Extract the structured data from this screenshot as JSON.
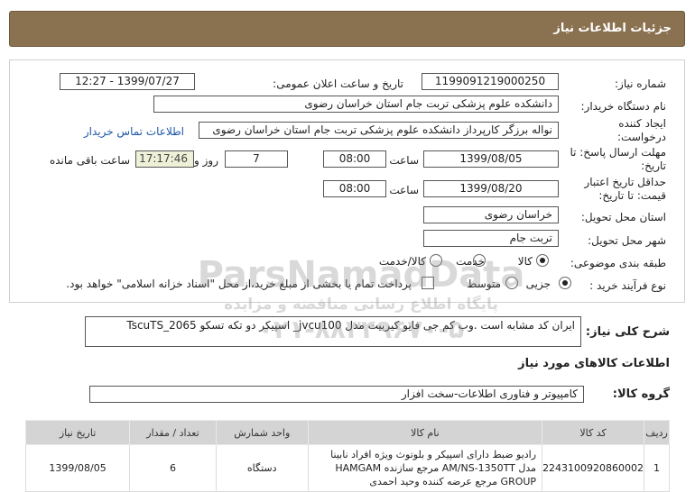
{
  "header": {
    "title": "جزئیات اطلاعات نیاز"
  },
  "form": {
    "need_number_label": "شماره نیاز:",
    "need_number": "1199091219000250",
    "announce_label": "تاریخ و ساعت اعلان عمومی:",
    "announce_value": "1399/07/27 - 12:27",
    "buyer_label": "نام دستگاه خریدار:",
    "buyer_value": "دانشکده علوم پزشکی تربت جام استان خراسان رضوی",
    "creator_label": "ایجاد کننده درخواست:",
    "creator_value": "نواله برزگر کارپرداز دانشکده علوم پزشکی تربت جام استان خراسان رضوی",
    "contact_link": "اطلاعات تماس خریدار",
    "send_deadline_label": "مهلت ارسال پاسخ: تا تاریخ:",
    "send_date": "1399/08/05",
    "time_label": "ساعت",
    "send_time": "08:00",
    "days_value": "7",
    "days_label": "روز و",
    "remaining_time": "17:17:46",
    "remaining_label": "ساعت باقی مانده",
    "validity_label": "حداقل تاریخ اعتبار قیمت: تا تاریخ:",
    "validity_date": "1399/08/20",
    "validity_time": "08:00",
    "province_label": "استان محل تحویل:",
    "province_value": "خراسان رضوی",
    "city_label": "شهر محل تحویل:",
    "city_value": "تربت جام",
    "category_label": "طبقه بندی موضوعی:",
    "category_options": [
      "کالا",
      "خدمت",
      "کالا/خدمت"
    ],
    "purchase_label": "نوع فرآیند خرید :",
    "purchase_options": [
      "جزیی",
      "متوسط"
    ],
    "purchase_note": "پرداخت تمام یا بخشی از مبلغ خرید،از محل \"اسناد خزانه اسلامی\" خواهد بود."
  },
  "description": {
    "label": "شرح کلی نیاز:",
    "value": "ایران کد مشابه است  .وب کم جی فایو کیربیت مدل jvcu100_ اسپیکر دو تکه تسکو TscuTS_2065"
  },
  "goods_info": {
    "section_title": "اطلاعات کالاهای مورد نیاز",
    "group_label": "گروه کالا:",
    "group_value": "کامپیوتر و فناوری اطلاعات-سخت افزار"
  },
  "table": {
    "headers": [
      "ردیف",
      "کد کالا",
      "نام کالا",
      "واحد شمارش",
      "تعداد / مقدار",
      "تاریخ نیاز"
    ],
    "rows": [
      {
        "row": "1",
        "code": "2243100920860002",
        "name": "رادیو ضبط دارای اسپیکر و بلوتوث ویژه افراد نابینا مدل AM/NS-1350TT مرجع سازنده HAMGAM GROUP مرجع عرضه کننده وحید احمدی",
        "unit": "دستگاه",
        "qty": "6",
        "date": "1399/08/05"
      }
    ]
  },
  "watermark": {
    "brand": "ParsNamadData",
    "line1": "پایگاه اطلاع رسانی مناقصه و مزایده",
    "line2": "۰۲۱-۸۸۳۴۹۶۷۰-۵"
  },
  "colors": {
    "header_bg": "#8a7150",
    "link": "#1d57a8",
    "table_header": "#d4d4d4"
  }
}
